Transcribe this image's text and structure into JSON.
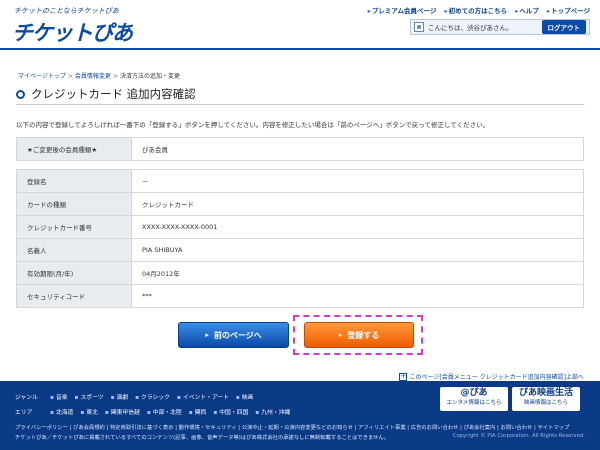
{
  "header": {
    "tagline": "チケットのことならチケットぴあ",
    "logo": "チケットぴあ",
    "top_links": [
      "プレミアム会員ページ",
      "初めての方はこちら",
      "ヘルプ",
      "トップページ"
    ],
    "greeting": "こんにちは、渋谷ぴあさん。",
    "logout_label": "ログアウト"
  },
  "breadcrumb": [
    "マイページトップ",
    "会員情報変更",
    "決済方法の追加・変更"
  ],
  "page_title": "クレジットカード 追加内容確認",
  "intro": "以下の内容で登録してよろしければ一番下の「登録する」ボタンを押してください。内容を修正したい場合は「前のページへ」ボタンで戻って修正してください。",
  "membership": {
    "label": "★ご変更後の会員種類★",
    "value": "ぴあ会員"
  },
  "details": [
    {
      "label": "登録名",
      "value": "－"
    },
    {
      "label": "カードの種類",
      "value": "クレジットカード"
    },
    {
      "label": "クレジットカード番号",
      "value": "XXXX-XXXX-XXXX-0001"
    },
    {
      "label": "名義人",
      "value": "PIA SHIBUYA"
    },
    {
      "label": "有効期限(月/年)",
      "value": "04月2012年"
    },
    {
      "label": "セキュリティコード",
      "value": "***"
    }
  ],
  "buttons": {
    "back": "前のページへ",
    "register": "登録する"
  },
  "page_note": "このページ[会員メニュー クレジットカード追加内容確認]上部へ",
  "footer": {
    "genre_label": "ジャンル",
    "genres": [
      "音楽",
      "スポーツ",
      "演劇",
      "クラシック",
      "イベント・アート",
      "映画"
    ],
    "area_label": "エリア",
    "areas": [
      "北海道",
      "東北",
      "関東甲信越",
      "中部・北陸",
      "関西",
      "中国・四国",
      "九州・沖縄"
    ],
    "banner1_title": "@ぴあ",
    "banner1_sub": "エンタメ情報はこちら",
    "banner2_title": "ぴあ映画生活",
    "banner2_sub": "映画情報はこちら",
    "links": "プライバシーポリシー | ぴあ会員規約 | 特定商取引法に基づく表示 | 動作環境・セキュリティ | 公演中止・延期・公演内容変更などのお知らせ | アフィリエイト事業 | 広告のお問い合わせ | ぴあ会社案内 | お問い合わせ | サイトマップ",
    "notice": "チケットぴあ／チケットぴあに掲載されているすべてのコンテンツ(記事、画像、音声データ等)はぴあ株式会社の承諾なしに無断転載することはできません。",
    "copyright": "Copyright © PIA Corporation. All Rights Reserved."
  }
}
